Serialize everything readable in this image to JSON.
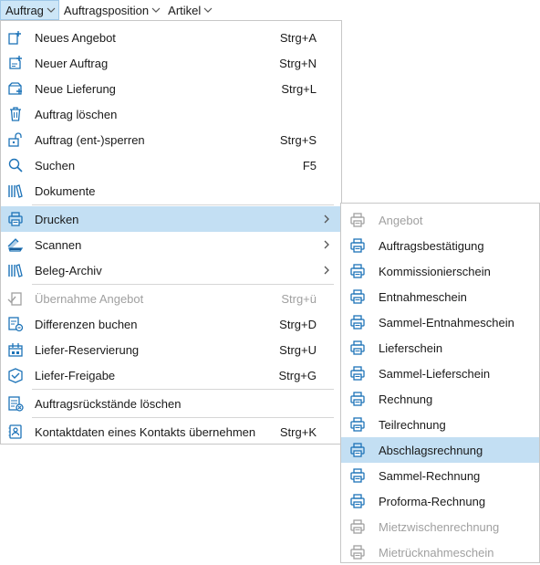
{
  "colors": {
    "accent": "#1d73b8",
    "highlight": "#c3dff3",
    "disabled": "#a0a0a0"
  },
  "menubar": [
    {
      "label": "Auftrag",
      "icon": "chevron-down-icon"
    },
    {
      "label": "Auftragsposition",
      "icon": "chevron-down-icon"
    },
    {
      "label": "Artikel",
      "icon": "chevron-down-icon"
    }
  ],
  "main_menu": [
    {
      "label": "Neues Angebot",
      "shortcut": "Strg+A",
      "icon": "new-offer-icon"
    },
    {
      "label": "Neuer Auftrag",
      "shortcut": "Strg+N",
      "icon": "new-order-icon"
    },
    {
      "label": "Neue Lieferung",
      "shortcut": "Strg+L",
      "icon": "new-delivery-icon"
    },
    {
      "label": "Auftrag löschen",
      "shortcut": "",
      "icon": "trash-icon"
    },
    {
      "label": "Auftrag (ent-)sperren",
      "shortcut": "Strg+S",
      "icon": "unlock-icon"
    },
    {
      "label": "Suchen",
      "shortcut": "F5",
      "icon": "search-icon"
    },
    {
      "label": "Dokumente",
      "shortcut": "",
      "icon": "documents-icon"
    },
    {
      "label": "Drucken",
      "shortcut": "",
      "icon": "printer-icon",
      "submenu": true,
      "selected": true
    },
    {
      "label": "Scannen",
      "shortcut": "",
      "icon": "scanner-icon",
      "submenu": true
    },
    {
      "label": "Beleg-Archiv",
      "shortcut": "",
      "icon": "archive-icon",
      "submenu": true
    },
    {
      "label": "Übernahme Angebot",
      "shortcut": "Strg+ü",
      "icon": "apply-offer-icon",
      "disabled": true
    },
    {
      "label": "Differenzen buchen",
      "shortcut": "Strg+D",
      "icon": "book-differences-icon"
    },
    {
      "label": "Liefer-Reservierung",
      "shortcut": "Strg+U",
      "icon": "delivery-reservation-icon"
    },
    {
      "label": "Liefer-Freigabe",
      "shortcut": "Strg+G",
      "icon": "delivery-release-icon"
    },
    {
      "label": "Auftragsrückstände löschen",
      "shortcut": "",
      "icon": "delete-backorders-icon"
    },
    {
      "label": "Kontaktdaten eines Kontakts übernehmen",
      "shortcut": "Strg+K",
      "icon": "contact-card-icon"
    }
  ],
  "submenu": [
    {
      "label": "Angebot",
      "disabled": true
    },
    {
      "label": "Auftragsbestätigung"
    },
    {
      "label": "Kommissionierschein"
    },
    {
      "label": "Entnahmeschein"
    },
    {
      "label": "Sammel-Entnahmeschein"
    },
    {
      "label": "Lieferschein"
    },
    {
      "label": "Sammel-Lieferschein"
    },
    {
      "label": "Rechnung"
    },
    {
      "label": "Teilrechnung"
    },
    {
      "label": "Abschlagsrechnung",
      "selected": true
    },
    {
      "label": "Sammel-Rechnung"
    },
    {
      "label": "Proforma-Rechnung"
    },
    {
      "label": "Mietzwischenrechnung",
      "disabled": true
    },
    {
      "label": "Mietrücknahmeschein",
      "disabled": true
    }
  ]
}
